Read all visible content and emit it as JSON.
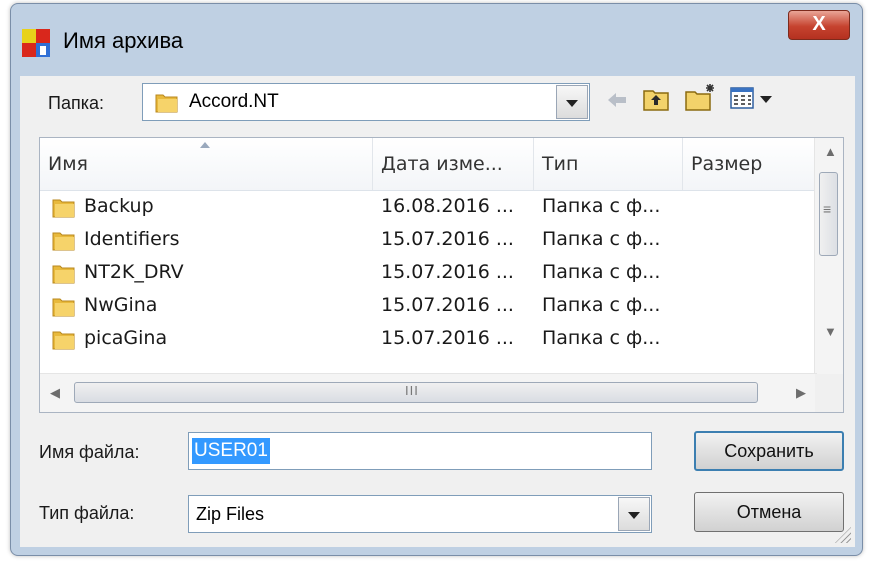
{
  "window": {
    "title": "Имя архива",
    "close_symbol": "X"
  },
  "folder_bar": {
    "label": "Папка:",
    "current_folder": "Accord.NT"
  },
  "toolbar": {
    "back_icon": "back-arrow-icon",
    "up_icon": "up-folder-icon",
    "new_folder_icon": "new-folder-icon",
    "view_menu_icon": "view-menu-icon"
  },
  "file_list": {
    "columns": [
      "Имя",
      "Дата изме...",
      "Тип",
      "Размер"
    ],
    "rows": [
      {
        "name": "Backup",
        "date": "16.08.2016 ...",
        "type": "Папка с ф...",
        "size": ""
      },
      {
        "name": "Identifiers",
        "date": "15.07.2016 ...",
        "type": "Папка с ф...",
        "size": ""
      },
      {
        "name": "NT2K_DRV",
        "date": "15.07.2016 ...",
        "type": "Папка с ф...",
        "size": ""
      },
      {
        "name": "NwGina",
        "date": "15.07.2016 ...",
        "type": "Папка с ф...",
        "size": ""
      },
      {
        "name": "picaGina",
        "date": "15.07.2016 ...",
        "type": "Папка с ф...",
        "size": ""
      }
    ],
    "hscroll_grip": "III",
    "vscroll_grip": "≡"
  },
  "filename": {
    "label": "Имя файла:",
    "value": "USER01"
  },
  "filetype": {
    "label": "Тип файла:",
    "value": "Zip Files"
  },
  "buttons": {
    "save": "Сохранить",
    "cancel": "Отмена"
  },
  "colors": {
    "selection": "#3399ff",
    "title_bar": "#bfd0e3",
    "close_button": "#c6432f",
    "folder": "#e8b93c"
  }
}
